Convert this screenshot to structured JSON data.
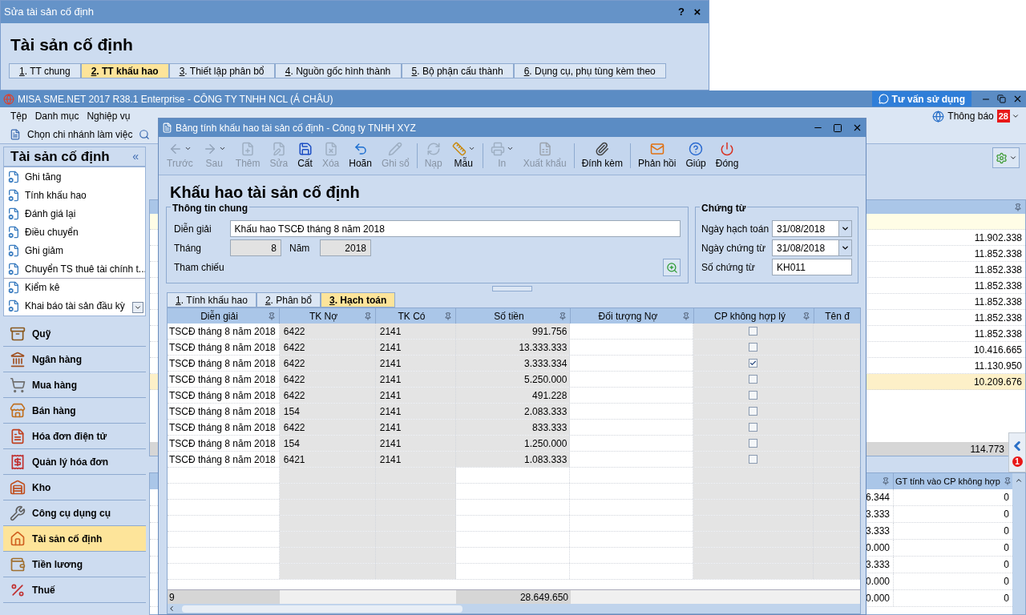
{
  "back_window": {
    "title": "Sửa tài sản cố định",
    "help": "?",
    "close": "×",
    "heading": "Tài sản cố định",
    "tabs": [
      {
        "key": "1",
        "label": ". TT chung",
        "selected": false
      },
      {
        "key": "2",
        "label": ". TT khấu hao",
        "selected": true
      },
      {
        "key": "3",
        "label": ". Thiết lập phân bổ",
        "selected": false
      },
      {
        "key": "4",
        "label": ". Nguồn gốc hình thành",
        "selected": false
      },
      {
        "key": "5",
        "label": ". Bộ phận cấu thành",
        "selected": false
      },
      {
        "key": "6",
        "label": ". Dụng cụ, phụ tùng kèm theo",
        "selected": false
      }
    ]
  },
  "app": {
    "title": "MISA SME.NET 2017 R38.1 Enterprise - CÔNG TY TNHH NCL (Á CHÂU)",
    "help_button": "Tư vấn sử dụng",
    "menu": [
      "Tệp",
      "Danh mục",
      "Nghiệp vụ"
    ],
    "notifications": {
      "label": "Thông báo",
      "count": "28"
    },
    "branch_button": "Chọn chi nhánh làm việc"
  },
  "sidebar": {
    "title": "Tài sản cố định",
    "collapse": "«",
    "items": [
      "Ghi tăng",
      "Tính khấu hao",
      "Đánh giá lại",
      "Điều chuyển",
      "Ghi giảm",
      "Chuyển TS thuê tài chính t...",
      "Kiểm kê",
      "Khai báo tài sản đầu kỳ"
    ],
    "modules": [
      {
        "label": "Quỹ",
        "selected": false
      },
      {
        "label": "Ngân hàng",
        "selected": false
      },
      {
        "label": "Mua hàng",
        "selected": false
      },
      {
        "label": "Bán hàng",
        "selected": false
      },
      {
        "label": "Hóa đơn điện tử",
        "selected": false
      },
      {
        "label": "Quản lý hóa đơn",
        "selected": false
      },
      {
        "label": "Kho",
        "selected": false
      },
      {
        "label": "Công cụ dụng cụ",
        "selected": false
      },
      {
        "label": "Tài sản cố định",
        "selected": true
      },
      {
        "label": "Tiền lương",
        "selected": false
      },
      {
        "label": "Thuế",
        "selected": false
      }
    ]
  },
  "asset_grid": {
    "rows": [
      {
        "value": "11.902.338",
        "selected": false
      },
      {
        "value": "11.852.338",
        "selected": false
      },
      {
        "value": "11.852.338",
        "selected": false
      },
      {
        "value": "11.852.338",
        "selected": false
      },
      {
        "value": "11.852.338",
        "selected": false
      },
      {
        "value": "11.852.338",
        "selected": false
      },
      {
        "value": "11.852.338",
        "selected": false
      },
      {
        "value": "10.416.665",
        "selected": false
      },
      {
        "value": "11.130.950",
        "selected": false
      },
      {
        "value": "10.209.676",
        "selected": true
      }
    ],
    "total": "114.773"
  },
  "detail_grid": {
    "column_2": "GT tính vào CP không hợp",
    "rows": [
      {
        "column_1": "6.344",
        "column_2": "0"
      },
      {
        "column_1": "3.333",
        "column_2": "0"
      },
      {
        "column_1": "3.333",
        "column_2": "0"
      },
      {
        "column_1": "0.000",
        "column_2": "0"
      },
      {
        "column_1": "3.333",
        "column_2": "0"
      },
      {
        "column_1": "0.000",
        "column_2": "0"
      },
      {
        "column_1": "0.000",
        "column_2": "0"
      }
    ]
  },
  "notice_badge": "1",
  "dialog": {
    "title": "Bảng tính khấu hao tài sản cố định - Công ty TNHH XYZ",
    "toolbar": [
      {
        "label": "Trước",
        "disabled": true,
        "dropdown": true
      },
      {
        "label": "Sau",
        "disabled": true,
        "dropdown": true
      },
      {
        "label": "Thêm",
        "disabled": true,
        "dropdown": false
      },
      {
        "label": "Sửa",
        "disabled": true,
        "dropdown": false
      },
      {
        "label": "Cất",
        "disabled": false,
        "dropdown": false
      },
      {
        "label": "Xóa",
        "disabled": true,
        "dropdown": false
      },
      {
        "label": "Hoãn",
        "disabled": false,
        "dropdown": false
      },
      {
        "label": "Ghi sổ",
        "disabled": true,
        "dropdown": false
      },
      {
        "label": "Nạp",
        "disabled": true,
        "dropdown": false
      },
      {
        "label": "Mẫu",
        "disabled": false,
        "dropdown": true
      },
      {
        "label": "In",
        "disabled": true,
        "dropdown": true
      },
      {
        "label": "Xuất khẩu",
        "disabled": true,
        "dropdown": false
      },
      {
        "label": "Đính kèm",
        "disabled": false,
        "dropdown": false
      },
      {
        "label": "Phản hồi",
        "disabled": false,
        "dropdown": false
      },
      {
        "label": "Giúp",
        "disabled": false,
        "dropdown": false
      },
      {
        "label": "Đóng",
        "disabled": false,
        "dropdown": false
      }
    ],
    "heading": "Khấu hao tài sản cố định",
    "general": {
      "title": "Thông tin chung",
      "description_label": "Diễn giải",
      "description": "Khấu hao TSCĐ tháng 8 năm 2018",
      "month_label": "Tháng",
      "month": "8",
      "year_label": "Năm",
      "year": "2018",
      "reference_label": "Tham chiếu"
    },
    "voucher": {
      "title": "Chứng từ",
      "posting_date_label": "Ngày hạch toán",
      "posting_date": "31/08/2018",
      "voucher_date_label": "Ngày chứng từ",
      "voucher_date": "31/08/2018",
      "number_label": "Số chứng từ",
      "number": "KH011"
    },
    "tabs": [
      {
        "key": "1",
        "label": ". Tính khấu hao",
        "selected": false
      },
      {
        "key": "2",
        "label": ". Phân bổ",
        "selected": false
      },
      {
        "key": "3",
        "label": ". Hạch toán",
        "selected": true
      }
    ],
    "columns": [
      "Diễn giải",
      "TK Nợ",
      "TK Có",
      "Số tiền",
      "Đối tượng Nợ",
      "CP không hợp lý",
      "Tên đ"
    ],
    "rows": [
      {
        "description": "TSCĐ tháng 8 năm 2018",
        "debit": "6422",
        "credit": "2141",
        "amount": "991.756",
        "checked": false
      },
      {
        "description": "TSCĐ tháng 8 năm 2018",
        "debit": "6422",
        "credit": "2141",
        "amount": "13.333.333",
        "checked": false
      },
      {
        "description": "TSCĐ tháng 8 năm 2018",
        "debit": "6422",
        "credit": "2141",
        "amount": "3.333.334",
        "checked": true
      },
      {
        "description": "TSCĐ tháng 8 năm 2018",
        "debit": "6422",
        "credit": "2141",
        "amount": "5.250.000",
        "checked": false
      },
      {
        "description": "TSCĐ tháng 8 năm 2018",
        "debit": "6422",
        "credit": "2141",
        "amount": "491.228",
        "checked": false
      },
      {
        "description": "TSCĐ tháng 8 năm 2018",
        "debit": "154",
        "credit": "2141",
        "amount": "2.083.333",
        "checked": false
      },
      {
        "description": "TSCĐ tháng 8 năm 2018",
        "debit": "6422",
        "credit": "2141",
        "amount": "833.333",
        "checked": false
      },
      {
        "description": "TSCĐ tháng 8 năm 2018",
        "debit": "154",
        "credit": "2141",
        "amount": "1.250.000",
        "checked": false
      },
      {
        "description": "TSCĐ tháng 8 năm 2018",
        "debit": "6421",
        "credit": "2141",
        "amount": "1.083.333",
        "checked": false
      }
    ],
    "footer": {
      "count": "9",
      "total": "28.649.650"
    }
  }
}
